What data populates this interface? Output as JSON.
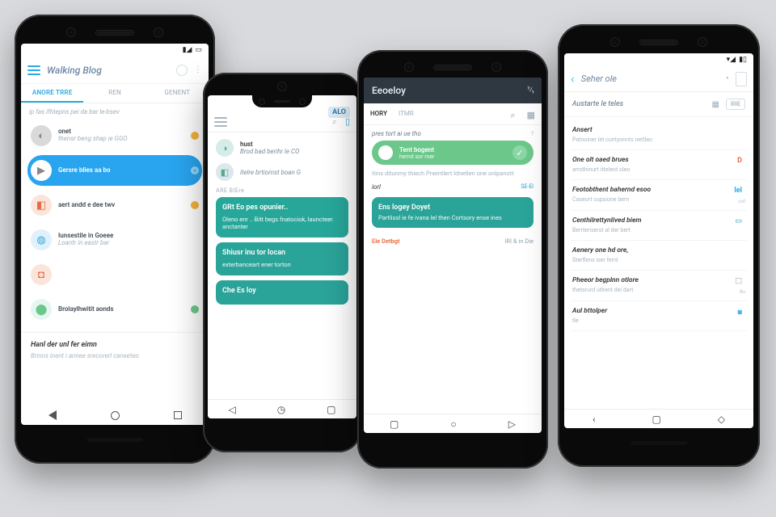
{
  "colors": {
    "accent_blue": "#29a4ef",
    "teal": "#27a79a",
    "green": "#6cc78a",
    "orange": "#f08a3c",
    "red": "#e86a3e",
    "slate": "#2f3741"
  },
  "phone1": {
    "app_title": "Walking Blog",
    "tabs": [
      "Anore Trre",
      "Ren",
      "Genent"
    ],
    "subhead": "ip fas ifhtepns pei da bar le-bsev",
    "items": [
      {
        "icon_bg": "#d9d9d9",
        "icon": "◐",
        "title": "onet",
        "sub": "thensr beng shap ie GGO",
        "dot": "#f6b23b"
      },
      {
        "icon_bg": "#ffffff",
        "icon": "▶",
        "title": "Gersre blies aa bo",
        "sub": "",
        "selected": true
      },
      {
        "icon_bg": "#fbe5da",
        "icon": "◧",
        "icon_color": "#e86a3e",
        "title": "aert andd e dee twv",
        "sub": "",
        "dot": "#f6b23b"
      },
      {
        "icon_bg": "#e0f1fb",
        "icon": "◍",
        "icon_color": "#2ca9e1",
        "title": "Iunsestile in Goeee",
        "sub": "Loantr in eastr bar"
      },
      {
        "icon_bg": "#fbe5da",
        "icon": "◘",
        "icon_color": "#e86a3e",
        "title": "",
        "sub": ""
      },
      {
        "icon_bg": "#e6f6f3",
        "icon": "⬤",
        "icon_color": "#6cc78a",
        "title": "Brolaylhwitit aonds",
        "sub": "",
        "dot": "#6cc78a"
      }
    ],
    "footer_title": "Hanl der unl fer eimn",
    "footer_sub": "Brinns inent i annee srecorerl caneeteo"
  },
  "phone2": {
    "chip": "ALO",
    "rows": [
      {
        "icon_bg": "#d6ece8",
        "icon": "◑",
        "title": "hust",
        "sub": "Brod bad berihr le CO"
      },
      {
        "icon_bg": "#dde7ee",
        "icon": "◧",
        "title": "",
        "sub": "itelre brtiornst boan G"
      }
    ],
    "section_label": "ARE BIEre",
    "bubbles": [
      {
        "title": "GRt Eo pes opunier..",
        "body": "Oleno enr ..\nBitt begs fnatociok, launcteer. anctanter"
      },
      {
        "title": "Shiusr inu tor locan",
        "body": "exterbanceart ener torton"
      },
      {
        "title": "Che Es loy",
        "body": ""
      }
    ]
  },
  "phone3": {
    "app_title": "Eeoeloy",
    "status": "⁷⁄₁",
    "tabs": [
      "HORY",
      "ITMR"
    ],
    "header": "pres tort ai ue tho",
    "pill": {
      "title": "Tent bogent",
      "sub": "hernd sor mer"
    },
    "para1": "itins ditunmy thiech\nPneintlert ldnetlen one onlpanott",
    "lines": [
      {
        "k": "iorl",
        "v": "SE-El"
      }
    ],
    "bubble": {
      "title": "Ens logey Doyet",
      "body": "Partlissl ie fe ivana lel then\nCortsory ense ines"
    },
    "footer": {
      "left": "Ele Detbgt",
      "right": "IRI & in Die"
    }
  },
  "phone4": {
    "app_title": "Seher ole",
    "sub_title": "Austarte le teles",
    "sub_chip": "IRIE",
    "cards": [
      {
        "title": "Ansert",
        "sub": "Patnoiner let cuntyonnts nettleo",
        "badge": "",
        "badge_color": ""
      },
      {
        "title": "One olt oaed brues",
        "sub": "arrothinurt itteleot oleo",
        "badge": "D",
        "badge_color": "#e86a3e"
      },
      {
        "title": "Feotobthent bahernd esoo",
        "sub": "Caseort cupsione bern",
        "badge": "lel",
        "badge_color": "#2ca9e1",
        "meta": "col"
      },
      {
        "title": "Centhilrettynlived biem",
        "sub": "Berrteriserst al der bert",
        "badge": "▭",
        "badge_color": "#7db8d4"
      },
      {
        "title": "Aenery one hd ore,",
        "sub": "Sterflens iser fernl",
        "badge": "",
        "badge_color": ""
      },
      {
        "title": "Pheeor begplnn otlore",
        "sub": "thetsrurd utlrent dei dart",
        "badge": "⬚",
        "badge_color": "#9db0bf",
        "meta": "du"
      },
      {
        "title": "Aul bttolper",
        "sub": "tle",
        "badge": "◙",
        "badge_color": "#2ca9e1"
      }
    ]
  }
}
